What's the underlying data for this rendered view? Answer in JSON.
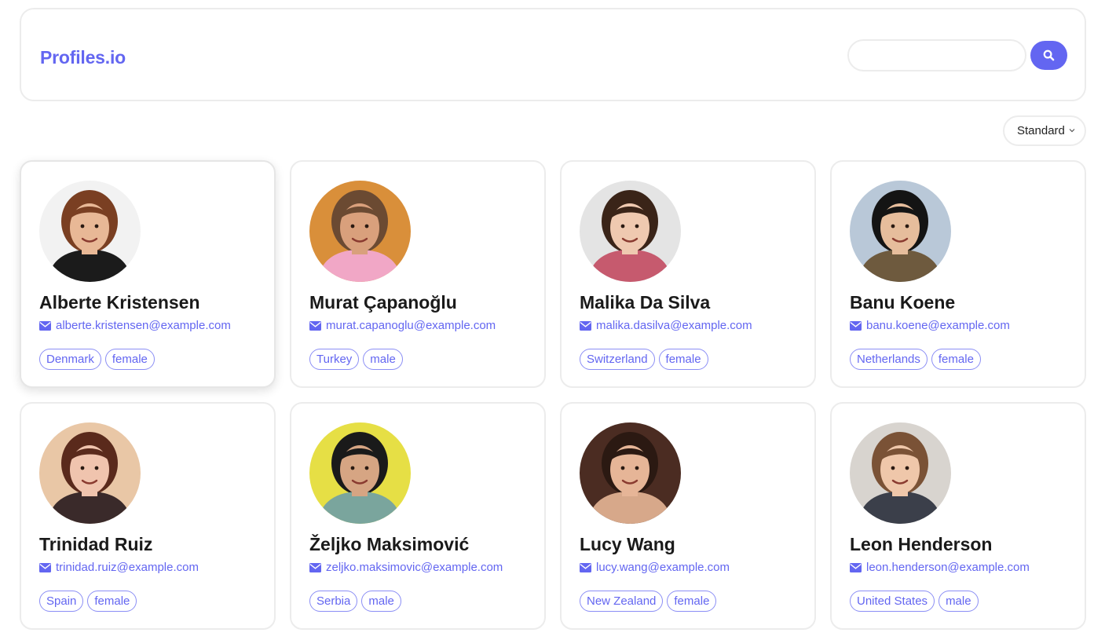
{
  "header": {
    "brand": "Profiles.io",
    "search": {
      "value": "",
      "placeholder": ""
    },
    "search_button_icon": "search-icon"
  },
  "sort": {
    "selected": "Standard",
    "icon": "chevron-down-icon"
  },
  "colors": {
    "accent": "#6366f1",
    "border": "#ececec",
    "text": "#1a1a1a"
  },
  "profiles": [
    {
      "name": "Alberte Kristensen",
      "email": "alberte.kristensen@example.com",
      "country": "Denmark",
      "gender": "female",
      "avatar": {
        "bg": "#f2f2f2",
        "skin": "#e8b896",
        "hair": "#7a3f22",
        "shirt": "#1b1b1b"
      }
    },
    {
      "name": "Murat Çapanoğlu",
      "email": "murat.capanoglu@example.com",
      "country": "Turkey",
      "gender": "male",
      "avatar": {
        "bg": "#d98f3a",
        "skin": "#d9a07c",
        "hair": "#6b4a32",
        "shirt": "#f1a7c6"
      }
    },
    {
      "name": "Malika Da Silva",
      "email": "malika.dasilva@example.com",
      "country": "Switzerland",
      "gender": "female",
      "avatar": {
        "bg": "#e4e4e4",
        "skin": "#efc9b0",
        "hair": "#3a2418",
        "shirt": "#c65a6e"
      }
    },
    {
      "name": "Banu Koene",
      "email": "banu.koene@example.com",
      "country": "Netherlands",
      "gender": "female",
      "avatar": {
        "bg": "#b9c8d8",
        "skin": "#e6bd9c",
        "hair": "#141414",
        "shirt": "#6e5a3e"
      }
    },
    {
      "name": "Trinidad Ruiz",
      "email": "trinidad.ruiz@example.com",
      "country": "Spain",
      "gender": "female",
      "avatar": {
        "bg": "#e9c7a6",
        "skin": "#f0c4ae",
        "hair": "#5a2a1c",
        "shirt": "#3a2a2a"
      }
    },
    {
      "name": "Željko Maksimović",
      "email": "zeljko.maksimovic@example.com",
      "country": "Serbia",
      "gender": "male",
      "avatar": {
        "bg": "#e6df45",
        "skin": "#d6a583",
        "hair": "#1a1a1a",
        "shirt": "#7aa59d"
      }
    },
    {
      "name": "Lucy Wang",
      "email": "lucy.wang@example.com",
      "country": "New Zealand",
      "gender": "female",
      "avatar": {
        "bg": "#4b2c22",
        "skin": "#e6b597",
        "hair": "#2b1912",
        "shirt": "#d7a88a"
      }
    },
    {
      "name": "Leon Henderson",
      "email": "leon.henderson@example.com",
      "country": "United States",
      "gender": "male",
      "avatar": {
        "bg": "#d8d4cf",
        "skin": "#efc7aa",
        "hair": "#7a5236",
        "shirt": "#3b3f4a"
      }
    }
  ],
  "email_icon": "envelope-icon"
}
